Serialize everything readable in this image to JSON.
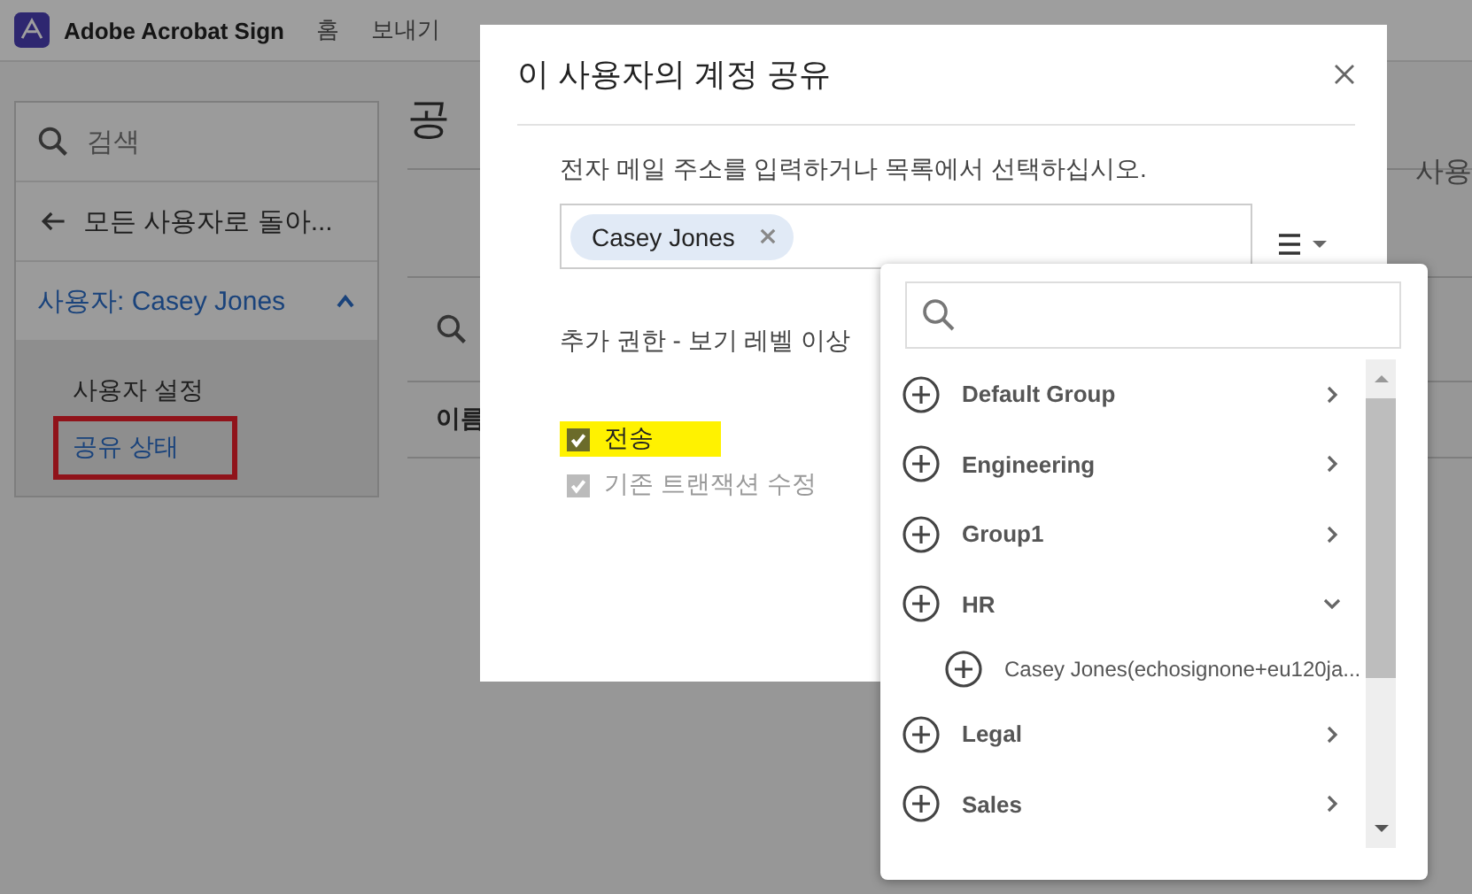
{
  "top_bar": {
    "app_name": "Adobe Acrobat Sign",
    "nav": [
      {
        "label": "홈"
      },
      {
        "label": "보내기"
      }
    ]
  },
  "sidebar": {
    "search_placeholder": "검색",
    "back_link": "모든 사용자로 돌아...",
    "user_section": {
      "label": "사용자: Casey Jones",
      "expanded": true,
      "items": [
        {
          "label": "사용자 설정",
          "selected": false,
          "outlined": false
        },
        {
          "label": "공유 상태",
          "selected": true,
          "outlined": true
        }
      ]
    }
  },
  "main": {
    "heading": "공",
    "column_1": "이름",
    "side_text": "사용"
  },
  "dialog": {
    "title": "이 사용자의 계정 공유",
    "prompt": "전자 메일 주소를 입력하거나 목록에서 선택하십시오.",
    "recipients": [
      {
        "name": "Casey Jones"
      }
    ],
    "permissions_title": "추가 권한 - 보기 레벨 이상",
    "permissions": [
      {
        "label": "전송",
        "checked": true,
        "disabled": false,
        "highlighted": true
      },
      {
        "label": "기존 트랜잭션 수정",
        "checked": true,
        "disabled": true,
        "highlighted": false
      }
    ]
  },
  "dropdown": {
    "groups": [
      {
        "name": "Default Group",
        "expanded": false
      },
      {
        "name": "Engineering",
        "expanded": false
      },
      {
        "name": "Group1",
        "expanded": false
      },
      {
        "name": "HR",
        "expanded": true,
        "children": [
          {
            "name": "Casey Jones(echosignone+eu120ja..."
          }
        ]
      },
      {
        "name": "Legal",
        "expanded": false
      },
      {
        "name": "Sales",
        "expanded": false
      }
    ]
  }
}
